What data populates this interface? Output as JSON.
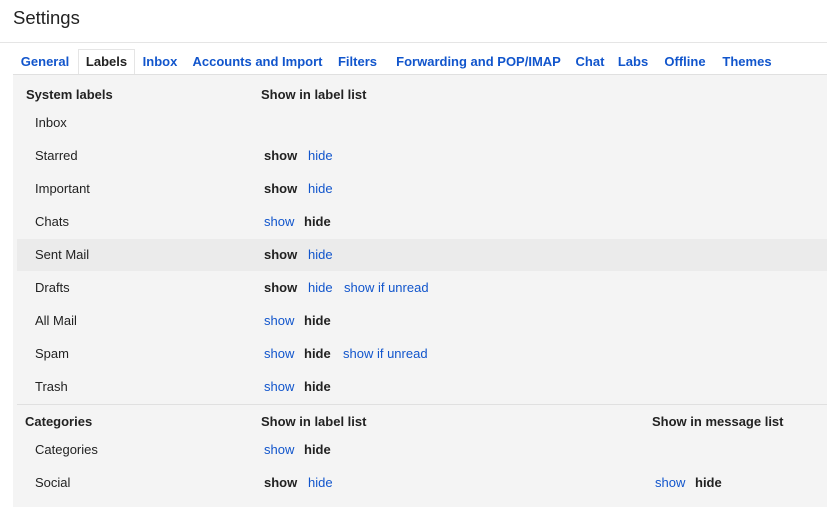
{
  "page": {
    "title": "Settings"
  },
  "tabs": [
    {
      "label": "General"
    },
    {
      "label": "Labels"
    },
    {
      "label": "Inbox"
    },
    {
      "label": "Accounts and Import"
    },
    {
      "label": "Filters"
    },
    {
      "label": "Forwarding and POP/IMAP"
    },
    {
      "label": "Chat"
    },
    {
      "label": "Labs"
    },
    {
      "label": "Offline"
    },
    {
      "label": "Themes"
    }
  ],
  "active_tab": "Labels",
  "system_labels": {
    "header": "System labels",
    "column_header": "Show in label list",
    "rows": [
      {
        "name": "Inbox"
      },
      {
        "name": "Starred",
        "show": "show",
        "hide": "hide"
      },
      {
        "name": "Important",
        "show": "show",
        "hide": "hide"
      },
      {
        "name": "Chats",
        "show": "show",
        "hide": "hide"
      },
      {
        "name": "Sent Mail",
        "show": "show",
        "hide": "hide"
      },
      {
        "name": "Drafts",
        "show": "show",
        "hide": "hide",
        "unread": "show if unread"
      },
      {
        "name": "All Mail",
        "show": "show",
        "hide": "hide"
      },
      {
        "name": "Spam",
        "show": "show",
        "hide": "hide",
        "unread": "show if unread"
      },
      {
        "name": "Trash",
        "show": "show",
        "hide": "hide"
      }
    ]
  },
  "categories": {
    "header": "Categories",
    "column_header": "Show in label list",
    "column_header_2": "Show in message list",
    "rows": [
      {
        "name": "Categories",
        "show": "show",
        "hide": "hide"
      },
      {
        "name": "Social",
        "show": "show",
        "hide": "hide",
        "msg_show": "show",
        "msg_hide": "hide"
      }
    ]
  },
  "colors": {
    "link": "#1155cc",
    "text": "#222222",
    "panel_bg": "#f4f4f4",
    "hover_row_bg": "#ebebeb"
  }
}
